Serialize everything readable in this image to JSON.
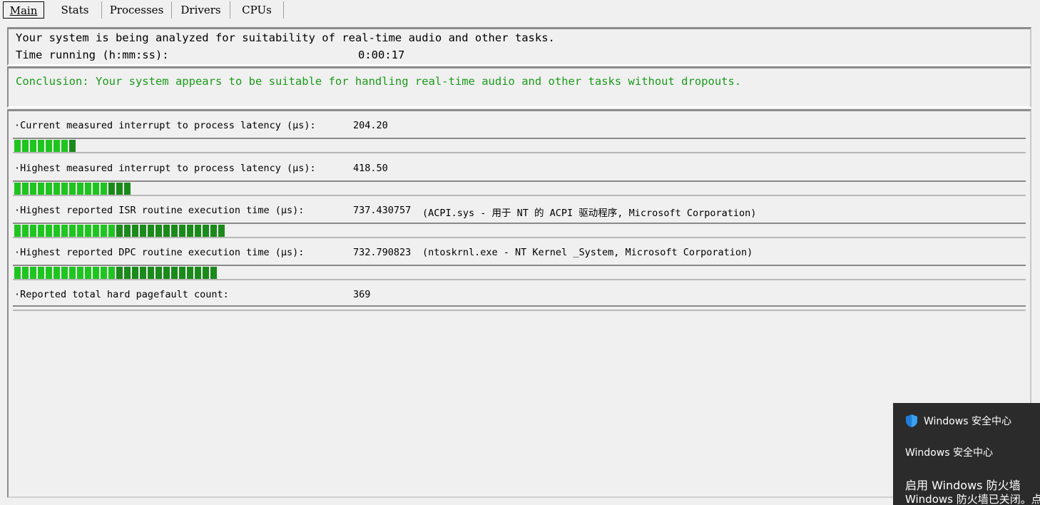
{
  "tabs": [
    {
      "label": "Main",
      "active": true
    },
    {
      "label": "Stats",
      "active": false
    },
    {
      "label": "Processes",
      "active": false
    },
    {
      "label": "Drivers",
      "active": false
    },
    {
      "label": "CPUs",
      "active": false
    }
  ],
  "status": {
    "analyzing_text": "Your system is being analyzed for suitability of real-time audio and other tasks.",
    "time_running_label": "Time running (h:mm:ss):",
    "time_running_value": "0:00:17"
  },
  "conclusion": {
    "text": "Conclusion: Your system appears to be suitable for handling real-time audio and other tasks without dropouts.",
    "color": "#1a9a1a"
  },
  "metrics": [
    {
      "label": "·Current measured interrupt to process latency (µs):",
      "value": "204.20",
      "extra": "",
      "bar_segments": 8,
      "bar_dark_segments": 1
    },
    {
      "label": "·Highest measured interrupt to process latency (µs):",
      "value": "418.50",
      "extra": "",
      "bar_segments": 15,
      "bar_dark_segments": 3
    },
    {
      "label": "·Highest reported ISR routine execution time (µs):",
      "value": "737.430757",
      "extra": "(ACPI.sys - 用于 NT 的 ACPI 驱动程序, Microsoft Corporation)",
      "bar_segments": 27,
      "bar_dark_segments": 14
    },
    {
      "label": "·Highest reported DPC routine execution time (µs):",
      "value": "732.790823",
      "extra": "(ntoskrnl.exe - NT Kernel _System, Microsoft Corporation)",
      "bar_segments": 26,
      "bar_dark_segments": 13
    },
    {
      "label": "·Reported total hard pagefault count:",
      "value": "369",
      "extra": "",
      "bar_segments": 0,
      "bar_dark_segments": 0
    }
  ],
  "notification": {
    "app_name": "Windows 安全中心",
    "subtitle": "Windows 安全中心",
    "title": "启用 Windows 防火墙",
    "body": "Windows 防火墙已关闭。点",
    "icon": "shield-icon",
    "background": "#2b2b2b"
  },
  "colors": {
    "bar_green": "#1fc51f",
    "bar_dark_green": "#1a8a1a"
  }
}
